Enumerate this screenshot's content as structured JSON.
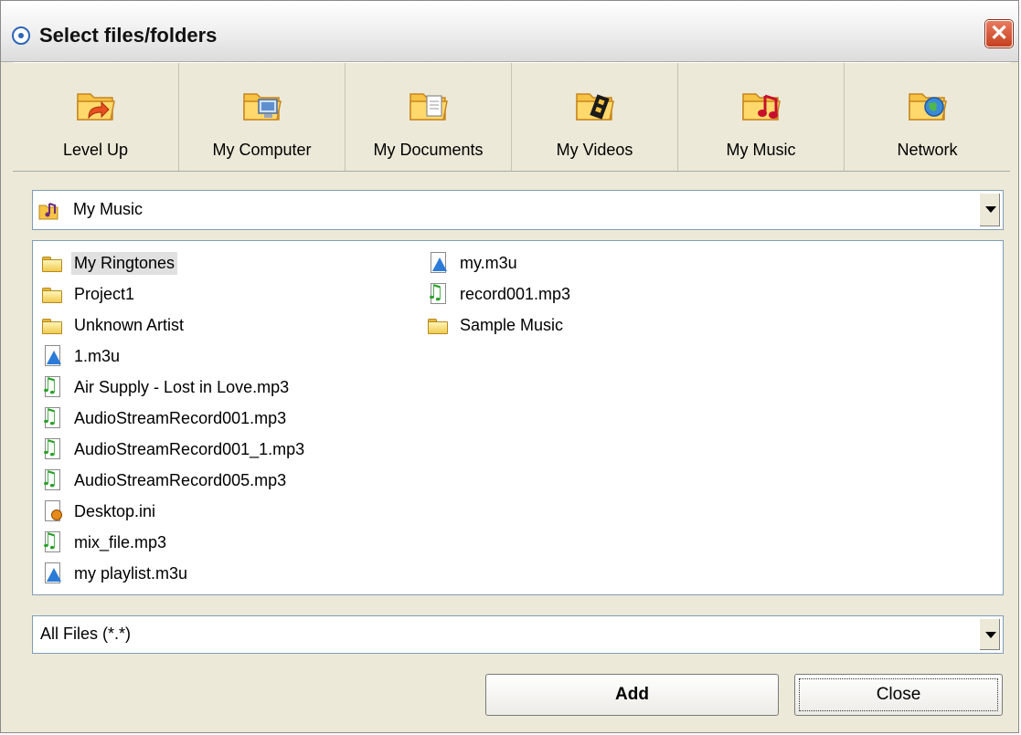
{
  "window": {
    "title": "Select files/folders",
    "close_glyph": "✕"
  },
  "toolbar": {
    "items": [
      {
        "label": "Level Up",
        "icon": "folder-level-up-icon"
      },
      {
        "label": "My Computer",
        "icon": "folder-computer-icon"
      },
      {
        "label": "My Documents",
        "icon": "folder-documents-icon"
      },
      {
        "label": "My Videos",
        "icon": "folder-videos-icon"
      },
      {
        "label": "My Music",
        "icon": "folder-music-icon"
      },
      {
        "label": "Network",
        "icon": "folder-network-icon"
      }
    ]
  },
  "location": {
    "value": "My Music",
    "icon": "my-music-folder-icon"
  },
  "files": {
    "column1": [
      {
        "name": "My Ringtones",
        "type": "folder",
        "selected": true
      },
      {
        "name": "Project1",
        "type": "folder"
      },
      {
        "name": "Unknown Artist",
        "type": "folder"
      },
      {
        "name": "1.m3u",
        "type": "m3u"
      },
      {
        "name": "Air Supply - Lost in Love.mp3",
        "type": "mp3"
      },
      {
        "name": "AudioStreamRecord001.mp3",
        "type": "mp3"
      },
      {
        "name": "AudioStreamRecord001_1.mp3",
        "type": "mp3"
      },
      {
        "name": "AudioStreamRecord005.mp3",
        "type": "mp3"
      },
      {
        "name": "Desktop.ini",
        "type": "ini"
      },
      {
        "name": "mix_file.mp3",
        "type": "mp3"
      },
      {
        "name": "my playlist.m3u",
        "type": "m3u"
      }
    ],
    "column2": [
      {
        "name": "my.m3u",
        "type": "m3u"
      },
      {
        "name": "record001.mp3",
        "type": "mp3"
      },
      {
        "name": "Sample Music",
        "type": "folder"
      }
    ]
  },
  "filter": {
    "value": "All Files (*.*)"
  },
  "buttons": {
    "add": "Add",
    "close": "Close"
  },
  "colors": {
    "folder": "#f1cb52",
    "accent": "#2c7bd8",
    "close": "#c4401f"
  }
}
